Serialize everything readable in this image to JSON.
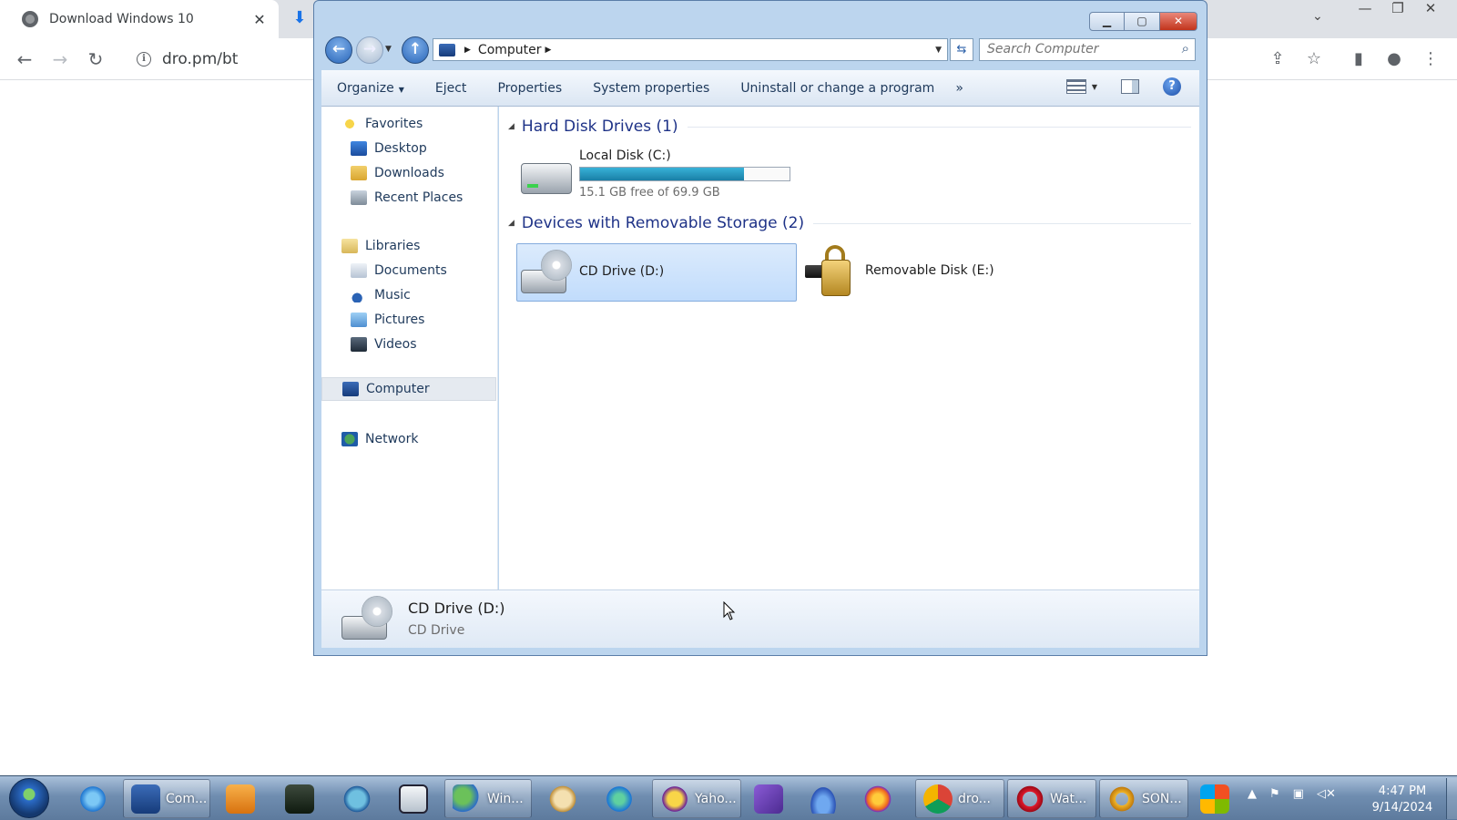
{
  "browser": {
    "tab_title": "Download Windows 10",
    "tab_close": "✕",
    "url": "dro.pm/bt"
  },
  "explorer": {
    "breadcrumb": "Computer",
    "search_placeholder": "Search Computer",
    "commands": {
      "organize": "Organize",
      "eject": "Eject",
      "properties": "Properties",
      "system_properties": "System properties",
      "uninstall": "Uninstall or change a program",
      "more": "»"
    },
    "nav": {
      "favorites": "Favorites",
      "desktop": "Desktop",
      "downloads": "Downloads",
      "recent_places": "Recent Places",
      "libraries": "Libraries",
      "documents": "Documents",
      "music": "Music",
      "pictures": "Pictures",
      "videos": "Videos",
      "computer": "Computer",
      "network": "Network"
    },
    "groups": {
      "hard_disks": "Hard Disk Drives (1)",
      "removable": "Devices with Removable Storage (2)"
    },
    "drives": {
      "local_disk": {
        "name": "Local Disk (C:)",
        "free_text": "15.1 GB free of 69.9 GB",
        "used_fraction": 0.784
      },
      "cd_drive": {
        "name": "CD Drive (D:)"
      },
      "removable_disk": {
        "name": "Removable Disk (E:)"
      }
    },
    "details": {
      "name": "CD Drive (D:)",
      "type": "CD Drive"
    }
  },
  "taskbar": {
    "buttons": [
      {
        "label": "Com...",
        "open": true
      },
      {
        "label": "Win...",
        "open": true
      },
      {
        "label": "Yaho...",
        "open": true
      },
      {
        "label": "dro...",
        "open": true
      },
      {
        "label": "Wat...",
        "open": true
      },
      {
        "label": "SON...",
        "open": true
      }
    ],
    "clock_time": "4:47 PM",
    "clock_date": "9/14/2024"
  },
  "colors": {
    "accent": "#2865b8",
    "selection": "#c1dcfc",
    "group_title": "#1e3287",
    "disk_fill": "#1a7fa6"
  }
}
